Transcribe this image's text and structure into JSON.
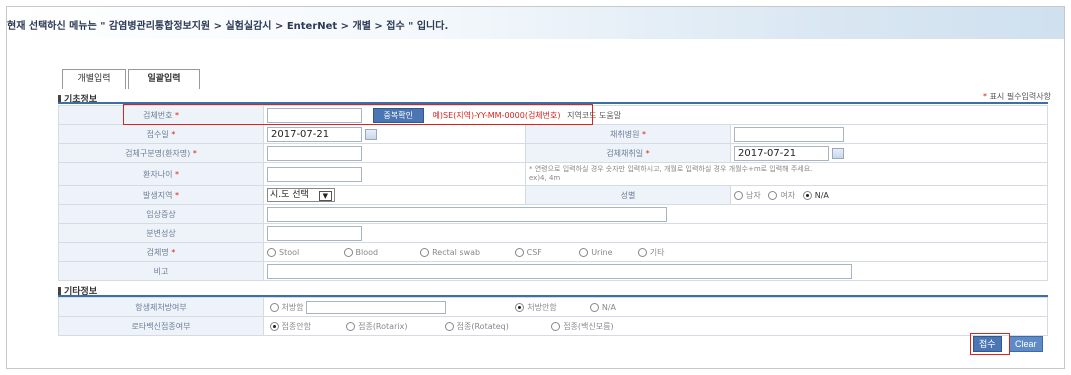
{
  "breadcrumb_message": "현재 선택하신 메뉴는 \" 감염병관리통합정보지원 > 실험실감시 > EnterNet > 개별 > 접수 \" 입니다.",
  "tabs": [
    {
      "label": "개별입력",
      "active": false
    },
    {
      "label": "일괄입력",
      "active": true
    }
  ],
  "section_basic": "기초정보",
  "section_other": "기타정보",
  "required_note": {
    "star": "*",
    "text": "표시 필수입력사항"
  },
  "basic": {
    "specimen_no": {
      "label": "검체번호",
      "star": "*",
      "value": "",
      "dup_button": "중복확인",
      "hint_red": "예)SE(지역)-YY-MM-0000(검체번호)",
      "hint": "지역코드 도움말"
    },
    "receipt_date": {
      "label": "접수일",
      "star": "*",
      "value": "2017-07-21"
    },
    "collect_hospital": {
      "label": "채취병원",
      "star": "*",
      "value": ""
    },
    "specimen_id": {
      "label": "검체구분명(환자명)",
      "star": "*",
      "value": ""
    },
    "collect_date": {
      "label": "검체채취일",
      "star": "*",
      "value": "2017-07-21"
    },
    "patient_age": {
      "label": "환자나이",
      "star": "*",
      "value": "",
      "note_line1": "* 연령으로 입력하실 경우 숫자만 입력하시고, 개월로 입력하실 경우 개월수+m로 입력해 주세요.",
      "note_line2": "ex)4, 4m"
    },
    "region": {
      "label": "발생지역",
      "star": "*",
      "select_value": "시.도 선택"
    },
    "sex": {
      "label": "성별",
      "options": [
        "남자",
        "여자",
        "N/A"
      ],
      "selected": "N/A"
    },
    "clinical_symptoms": {
      "label": "임상증상",
      "value": ""
    },
    "stool_character": {
      "label": "분변성상",
      "value": ""
    },
    "specimen_type": {
      "label": "검체명",
      "star": "*",
      "options": [
        "Stool",
        "Blood",
        "Rectal swab",
        "CSF",
        "Urine",
        "기타"
      ]
    },
    "remarks": {
      "label": "비고",
      "value": ""
    }
  },
  "other": {
    "antibiotic": {
      "label": "항생제처방여부",
      "options": [
        "처방함",
        "처방안함",
        "N/A"
      ],
      "selected": "처방안함",
      "input_value": ""
    },
    "rotavirus": {
      "label": "로타백신접종여부",
      "options": [
        "접종안함",
        "접종(Rotarix)",
        "접종(Rotateq)",
        "접종(백신모름)"
      ],
      "selected": "접종안함"
    }
  },
  "buttons": {
    "accept": "접수",
    "clear": "Clear"
  },
  "colors": {
    "accent": "#4b76b3",
    "required": "#d9231d",
    "label_bg": "#eef3fa",
    "section_line": "#3c6fa8"
  }
}
